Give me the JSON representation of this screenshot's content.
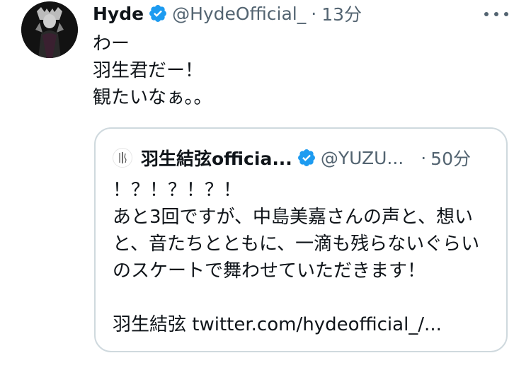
{
  "tweet": {
    "display_name": "Hyde",
    "handle": "@HydeOfficial_",
    "separator": "·",
    "time": "13分",
    "lines": [
      "わー",
      "羽生君だー！",
      "観たいなぁ。。"
    ]
  },
  "quote": {
    "display_name": "羽生結弦officia...",
    "handle": "@YUZU...",
    "separator": "·",
    "time": "50分",
    "lines": [
      "！？！？！？！",
      "あと3回ですが、中島美嘉さんの声と、想い",
      "と、音たちとともに、一滴も残らないぐらい",
      "のスケートで舞わせていただきます！"
    ],
    "signature": "羽生結弦",
    "link": "twitter.com/hydeofficial_/..."
  },
  "colors": {
    "text": "#0f1419",
    "secondary": "#536471",
    "verified": "#1d9bf0",
    "border": "#cfd9de"
  },
  "icons": {
    "verified": "verified-badge-icon",
    "more": "more-options-icon"
  }
}
